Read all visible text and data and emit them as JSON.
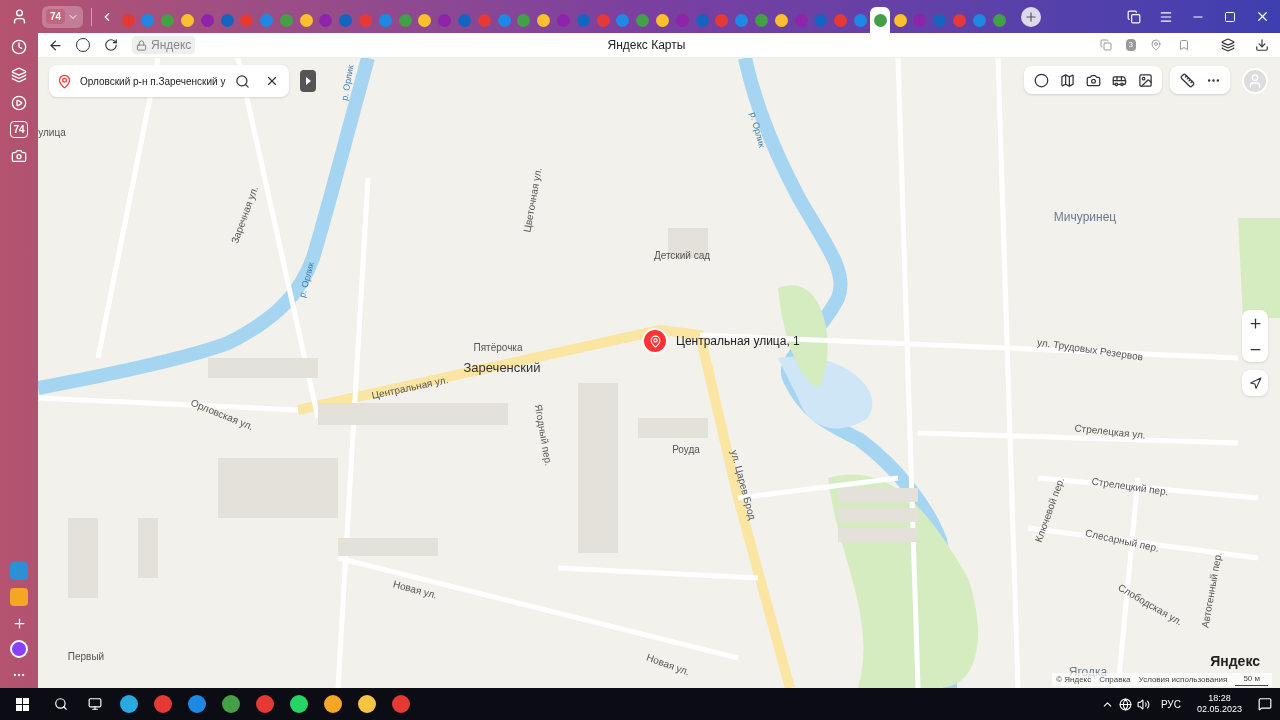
{
  "tabs": [
    {
      "selected": false
    },
    {
      "selected": false
    },
    {
      "selected": false
    },
    {
      "selected": false
    },
    {
      "selected": false
    },
    {
      "selected": false
    },
    {
      "selected": false
    },
    {
      "selected": false
    },
    {
      "selected": false
    },
    {
      "selected": false
    },
    {
      "selected": false
    },
    {
      "selected": false
    },
    {
      "selected": false
    },
    {
      "selected": false
    },
    {
      "selected": false
    },
    {
      "selected": false
    },
    {
      "selected": false
    },
    {
      "selected": false
    },
    {
      "selected": false
    },
    {
      "selected": false
    },
    {
      "selected": false
    },
    {
      "selected": false
    },
    {
      "selected": false
    },
    {
      "selected": false
    },
    {
      "selected": false
    },
    {
      "selected": false
    },
    {
      "selected": false
    },
    {
      "selected": false
    },
    {
      "selected": false
    },
    {
      "selected": false
    },
    {
      "selected": false
    },
    {
      "selected": false
    },
    {
      "selected": false
    },
    {
      "selected": false
    },
    {
      "selected": false
    },
    {
      "selected": false
    },
    {
      "selected": false
    },
    {
      "selected": false
    },
    {
      "selected": true
    },
    {
      "selected": false
    },
    {
      "selected": false
    },
    {
      "selected": false
    },
    {
      "selected": false
    },
    {
      "selected": false
    },
    {
      "selected": false
    }
  ],
  "browser": {
    "tab_counter": "74",
    "sidebar_badge": "74",
    "address": "Яндекс",
    "page_title": "Яндекс Карты",
    "extension_badge": "3"
  },
  "search": {
    "value": "Орловский р-н п.Зареченский у"
  },
  "map": {
    "marker_label": "Центральная улица, 1",
    "labels": [
      {
        "text": "Зареченский",
        "kind": "place"
      },
      {
        "text": "Пятёрочка",
        "kind": "poi"
      },
      {
        "text": "Центральная ул.",
        "kind": "street"
      },
      {
        "text": "Орловская ул.",
        "kind": "street"
      },
      {
        "text": "Ягодный пер.",
        "kind": "street"
      },
      {
        "text": "ул. Царев Брод",
        "kind": "street"
      },
      {
        "text": "Детский сад",
        "kind": "poi"
      },
      {
        "text": "Роуда",
        "kind": "poi"
      },
      {
        "text": "Мичуринец",
        "kind": "district"
      },
      {
        "text": "ул. Трудовых Резервов",
        "kind": "street"
      },
      {
        "text": "Стрелецкая ул.",
        "kind": "street"
      },
      {
        "text": "Стрелецкий пер.",
        "kind": "street"
      },
      {
        "text": "Слесарный пер.",
        "kind": "street"
      },
      {
        "text": "Слободская ул.",
        "kind": "street"
      },
      {
        "text": "Новая ул.",
        "kind": "street"
      },
      {
        "text": "Новая ул.",
        "kind": "street"
      },
      {
        "text": "Первый",
        "kind": "poi"
      },
      {
        "text": "Ягодка",
        "kind": "district"
      },
      {
        "text": "р. Орлик",
        "kind": "water"
      },
      {
        "text": "р. Орлик",
        "kind": "water"
      },
      {
        "text": "Цветочная ул.",
        "kind": "street"
      },
      {
        "text": "Заречная ул.",
        "kind": "street"
      },
      {
        "text": "Ключевой пер.",
        "kind": "street"
      },
      {
        "text": "Автогенный пер.",
        "kind": "street"
      },
      {
        "text": "р. Орлик",
        "kind": "water"
      },
      {
        "text": "улица",
        "kind": "street"
      }
    ],
    "logo": "Яндекс",
    "footer_links": [
      "© Яндекс",
      "Справка",
      "Условия использования"
    ],
    "scale": "50 м"
  },
  "taskbar": {
    "language": "РУС",
    "time": "18:28",
    "date": "02.05.2023"
  }
}
